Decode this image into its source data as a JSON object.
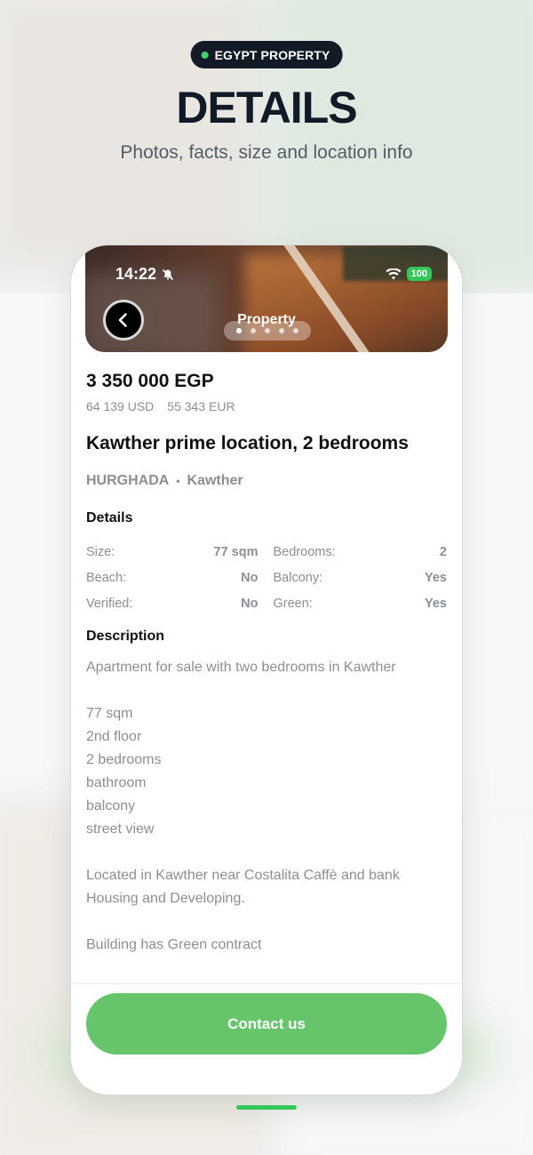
{
  "header": {
    "badge": "EGYPT PROPERTY",
    "title": "DETAILS",
    "subtitle": "Photos, facts, size and location info"
  },
  "status_bar": {
    "time": "14:22",
    "battery": "100"
  },
  "hero": {
    "title": "Property",
    "photo_count": 5,
    "active_photo": 1
  },
  "listing": {
    "price": "3 350 000 EGP",
    "price_usd": "64 139 USD",
    "price_eur": "55 343 EUR",
    "title": "Kawther prime location, 2 bedrooms",
    "city": "HURGHADA",
    "separator": "•",
    "district": "Kawther"
  },
  "details": {
    "heading": "Details",
    "rows": [
      {
        "left_key": "Size:",
        "left_val": "77 sqm",
        "right_key": "Bedrooms:",
        "right_val": "2"
      },
      {
        "left_key": "Beach:",
        "left_val": "No",
        "right_key": "Balcony:",
        "right_val": "Yes"
      },
      {
        "left_key": "Verified:",
        "left_val": "No",
        "right_key": "Green:",
        "right_val": "Yes"
      }
    ]
  },
  "description": {
    "heading": "Description",
    "lines": [
      "Apartment for sale with two bedrooms in Kawther",
      "",
      "77 sqm",
      "2nd floor",
      "2 bedrooms",
      "bathroom",
      "balcony",
      "street view",
      "",
      "Located in Kawther near Costalita Caffè and bank",
      "Housing and Developing.",
      "",
      "Building has Green contract"
    ]
  },
  "actions": {
    "contact_label": "Contact us"
  },
  "colors": {
    "accent": "#66c56b",
    "badge_bg": "#121a26",
    "badge_dot": "#3fd26a"
  },
  "icons": {
    "back": "chevron-left-icon",
    "mute": "bell-slash-icon",
    "wifi": "wifi-icon"
  }
}
